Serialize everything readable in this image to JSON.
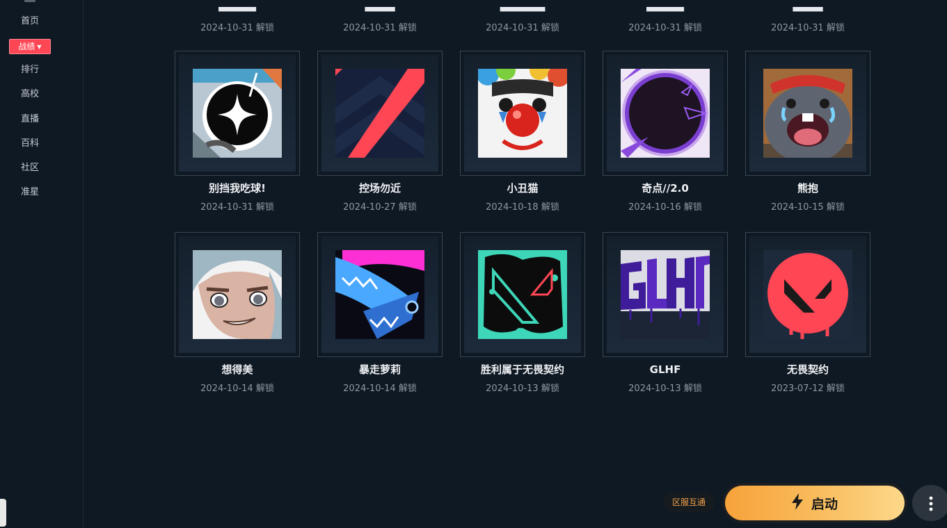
{
  "sidebar": {
    "items": [
      {
        "label": "首页"
      },
      {
        "label": "战绩"
      },
      {
        "label": "排行"
      },
      {
        "label": "高校"
      },
      {
        "label": "直播"
      },
      {
        "label": "百科"
      },
      {
        "label": "社区"
      },
      {
        "label": "准星"
      }
    ]
  },
  "partial_row": [
    {
      "date": "2024-10-31 解锁"
    },
    {
      "date": "2024-10-31 解锁"
    },
    {
      "date": "2024-10-31 解锁"
    },
    {
      "date": "2024-10-31 解锁"
    },
    {
      "date": "2024-10-31 解锁"
    }
  ],
  "cards": [
    {
      "name": "别挡我吃球!",
      "date": "2024-10-31 解锁",
      "icon": "black-star-ball-icon"
    },
    {
      "name": "控场勿近",
      "date": "2024-10-27 解锁",
      "icon": "red-stripe-chevron-icon"
    },
    {
      "name": "小丑猫",
      "date": "2024-10-18 解锁",
      "icon": "clown-cat-icon"
    },
    {
      "name": "奇点//2.0",
      "date": "2024-10-16 解锁",
      "icon": "purple-portal-icon"
    },
    {
      "name": "熊抱",
      "date": "2024-10-15 解锁",
      "icon": "crying-seal-icon"
    },
    {
      "name": "想得美",
      "date": "2024-10-14 解锁",
      "icon": "smirking-girl-icon"
    },
    {
      "name": "暴走萝莉",
      "date": "2024-10-14 解锁",
      "icon": "neon-shark-icon"
    },
    {
      "name": "胜利属于无畏契约",
      "date": "2024-10-13 解锁",
      "icon": "valorant-splatter-icon"
    },
    {
      "name": "GLHF",
      "date": "2024-10-13 解锁",
      "icon": "glhf-graffiti-icon"
    },
    {
      "name": "无畏契约",
      "date": "2023-07-12 解锁",
      "icon": "valorant-red-logo-icon"
    }
  ],
  "footer": {
    "region_label": "区服互通",
    "launch_label": "启动"
  },
  "colors": {
    "background": "#0f1923",
    "accent": "#ff4655",
    "launch_start": "#f7a23a",
    "launch_end": "#fcd88a"
  }
}
